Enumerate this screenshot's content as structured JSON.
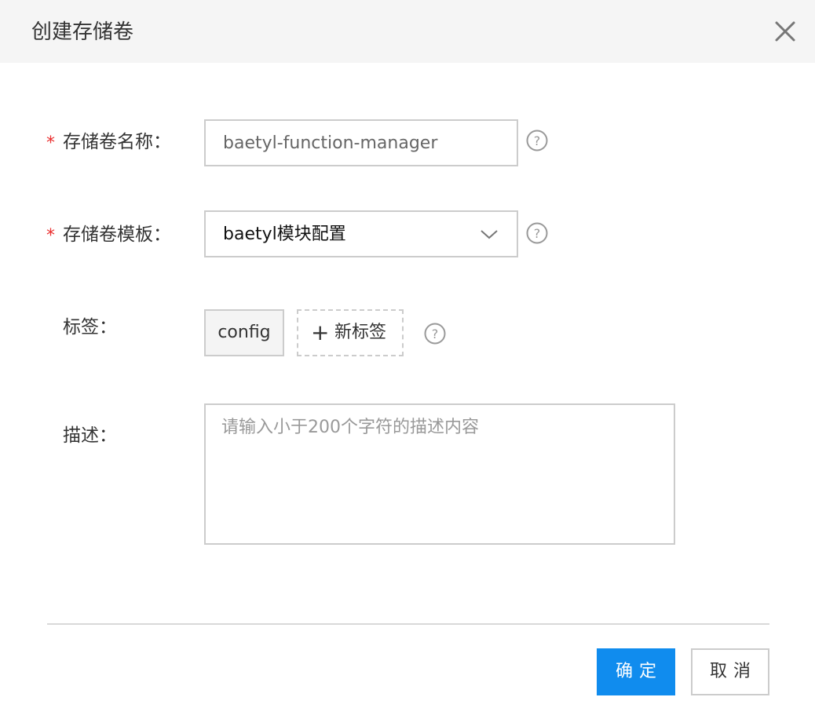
{
  "dialog": {
    "title": "创建存储卷",
    "close_icon": "close-icon"
  },
  "form": {
    "required_mark": "*",
    "name": {
      "label": "存储卷名称：",
      "value": "baetyl-function-manager",
      "required": true,
      "help_icon": "question-circle-icon"
    },
    "template": {
      "label": "存储卷模板：",
      "selected": "baetyl模块配置",
      "required": true,
      "dropdown_icon": "chevron-down-icon",
      "help_icon": "question-circle-icon"
    },
    "tags": {
      "label": "标签：",
      "items": [
        "config"
      ],
      "add_label": "新标签",
      "add_icon": "plus-icon",
      "help_icon": "question-circle-icon"
    },
    "description": {
      "label": "描述：",
      "value": "",
      "placeholder": "请输入小于200个字符的描述内容"
    }
  },
  "footer": {
    "confirm_label": "确定",
    "cancel_label": "取消"
  },
  "colors": {
    "primary": "#108cee",
    "required": "#ea2e2e",
    "border": "#cccccc",
    "header_bg": "#f5f5f5"
  }
}
